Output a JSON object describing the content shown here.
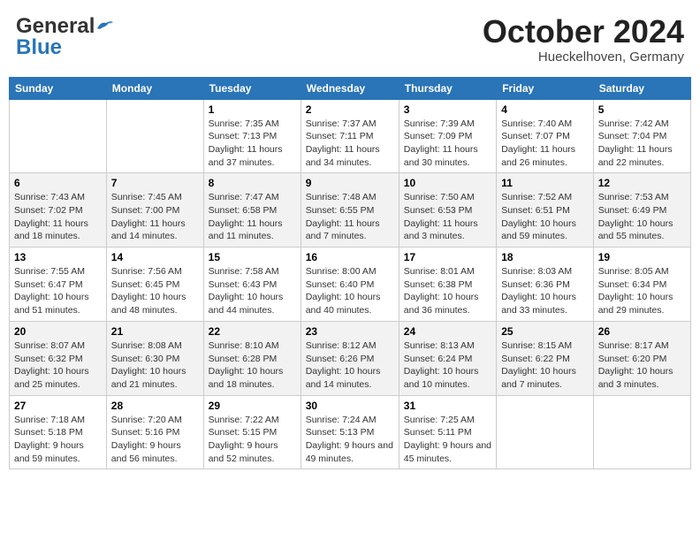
{
  "header": {
    "logo_general": "General",
    "logo_blue": "Blue",
    "month": "October 2024",
    "location": "Hueckelhoven, Germany"
  },
  "days_of_week": [
    "Sunday",
    "Monday",
    "Tuesday",
    "Wednesday",
    "Thursday",
    "Friday",
    "Saturday"
  ],
  "weeks": [
    [
      {
        "day": "",
        "sunrise": "",
        "sunset": "",
        "daylight": ""
      },
      {
        "day": "",
        "sunrise": "",
        "sunset": "",
        "daylight": ""
      },
      {
        "day": "1",
        "sunrise": "Sunrise: 7:35 AM",
        "sunset": "Sunset: 7:13 PM",
        "daylight": "Daylight: 11 hours and 37 minutes."
      },
      {
        "day": "2",
        "sunrise": "Sunrise: 7:37 AM",
        "sunset": "Sunset: 7:11 PM",
        "daylight": "Daylight: 11 hours and 34 minutes."
      },
      {
        "day": "3",
        "sunrise": "Sunrise: 7:39 AM",
        "sunset": "Sunset: 7:09 PM",
        "daylight": "Daylight: 11 hours and 30 minutes."
      },
      {
        "day": "4",
        "sunrise": "Sunrise: 7:40 AM",
        "sunset": "Sunset: 7:07 PM",
        "daylight": "Daylight: 11 hours and 26 minutes."
      },
      {
        "day": "5",
        "sunrise": "Sunrise: 7:42 AM",
        "sunset": "Sunset: 7:04 PM",
        "daylight": "Daylight: 11 hours and 22 minutes."
      }
    ],
    [
      {
        "day": "6",
        "sunrise": "Sunrise: 7:43 AM",
        "sunset": "Sunset: 7:02 PM",
        "daylight": "Daylight: 11 hours and 18 minutes."
      },
      {
        "day": "7",
        "sunrise": "Sunrise: 7:45 AM",
        "sunset": "Sunset: 7:00 PM",
        "daylight": "Daylight: 11 hours and 14 minutes."
      },
      {
        "day": "8",
        "sunrise": "Sunrise: 7:47 AM",
        "sunset": "Sunset: 6:58 PM",
        "daylight": "Daylight: 11 hours and 11 minutes."
      },
      {
        "day": "9",
        "sunrise": "Sunrise: 7:48 AM",
        "sunset": "Sunset: 6:55 PM",
        "daylight": "Daylight: 11 hours and 7 minutes."
      },
      {
        "day": "10",
        "sunrise": "Sunrise: 7:50 AM",
        "sunset": "Sunset: 6:53 PM",
        "daylight": "Daylight: 11 hours and 3 minutes."
      },
      {
        "day": "11",
        "sunrise": "Sunrise: 7:52 AM",
        "sunset": "Sunset: 6:51 PM",
        "daylight": "Daylight: 10 hours and 59 minutes."
      },
      {
        "day": "12",
        "sunrise": "Sunrise: 7:53 AM",
        "sunset": "Sunset: 6:49 PM",
        "daylight": "Daylight: 10 hours and 55 minutes."
      }
    ],
    [
      {
        "day": "13",
        "sunrise": "Sunrise: 7:55 AM",
        "sunset": "Sunset: 6:47 PM",
        "daylight": "Daylight: 10 hours and 51 minutes."
      },
      {
        "day": "14",
        "sunrise": "Sunrise: 7:56 AM",
        "sunset": "Sunset: 6:45 PM",
        "daylight": "Daylight: 10 hours and 48 minutes."
      },
      {
        "day": "15",
        "sunrise": "Sunrise: 7:58 AM",
        "sunset": "Sunset: 6:43 PM",
        "daylight": "Daylight: 10 hours and 44 minutes."
      },
      {
        "day": "16",
        "sunrise": "Sunrise: 8:00 AM",
        "sunset": "Sunset: 6:40 PM",
        "daylight": "Daylight: 10 hours and 40 minutes."
      },
      {
        "day": "17",
        "sunrise": "Sunrise: 8:01 AM",
        "sunset": "Sunset: 6:38 PM",
        "daylight": "Daylight: 10 hours and 36 minutes."
      },
      {
        "day": "18",
        "sunrise": "Sunrise: 8:03 AM",
        "sunset": "Sunset: 6:36 PM",
        "daylight": "Daylight: 10 hours and 33 minutes."
      },
      {
        "day": "19",
        "sunrise": "Sunrise: 8:05 AM",
        "sunset": "Sunset: 6:34 PM",
        "daylight": "Daylight: 10 hours and 29 minutes."
      }
    ],
    [
      {
        "day": "20",
        "sunrise": "Sunrise: 8:07 AM",
        "sunset": "Sunset: 6:32 PM",
        "daylight": "Daylight: 10 hours and 25 minutes."
      },
      {
        "day": "21",
        "sunrise": "Sunrise: 8:08 AM",
        "sunset": "Sunset: 6:30 PM",
        "daylight": "Daylight: 10 hours and 21 minutes."
      },
      {
        "day": "22",
        "sunrise": "Sunrise: 8:10 AM",
        "sunset": "Sunset: 6:28 PM",
        "daylight": "Daylight: 10 hours and 18 minutes."
      },
      {
        "day": "23",
        "sunrise": "Sunrise: 8:12 AM",
        "sunset": "Sunset: 6:26 PM",
        "daylight": "Daylight: 10 hours and 14 minutes."
      },
      {
        "day": "24",
        "sunrise": "Sunrise: 8:13 AM",
        "sunset": "Sunset: 6:24 PM",
        "daylight": "Daylight: 10 hours and 10 minutes."
      },
      {
        "day": "25",
        "sunrise": "Sunrise: 8:15 AM",
        "sunset": "Sunset: 6:22 PM",
        "daylight": "Daylight: 10 hours and 7 minutes."
      },
      {
        "day": "26",
        "sunrise": "Sunrise: 8:17 AM",
        "sunset": "Sunset: 6:20 PM",
        "daylight": "Daylight: 10 hours and 3 minutes."
      }
    ],
    [
      {
        "day": "27",
        "sunrise": "Sunrise: 7:18 AM",
        "sunset": "Sunset: 5:18 PM",
        "daylight": "Daylight: 9 hours and 59 minutes."
      },
      {
        "day": "28",
        "sunrise": "Sunrise: 7:20 AM",
        "sunset": "Sunset: 5:16 PM",
        "daylight": "Daylight: 9 hours and 56 minutes."
      },
      {
        "day": "29",
        "sunrise": "Sunrise: 7:22 AM",
        "sunset": "Sunset: 5:15 PM",
        "daylight": "Daylight: 9 hours and 52 minutes."
      },
      {
        "day": "30",
        "sunrise": "Sunrise: 7:24 AM",
        "sunset": "Sunset: 5:13 PM",
        "daylight": "Daylight: 9 hours and 49 minutes."
      },
      {
        "day": "31",
        "sunrise": "Sunrise: 7:25 AM",
        "sunset": "Sunset: 5:11 PM",
        "daylight": "Daylight: 9 hours and 45 minutes."
      },
      {
        "day": "",
        "sunrise": "",
        "sunset": "",
        "daylight": ""
      },
      {
        "day": "",
        "sunrise": "",
        "sunset": "",
        "daylight": ""
      }
    ]
  ]
}
